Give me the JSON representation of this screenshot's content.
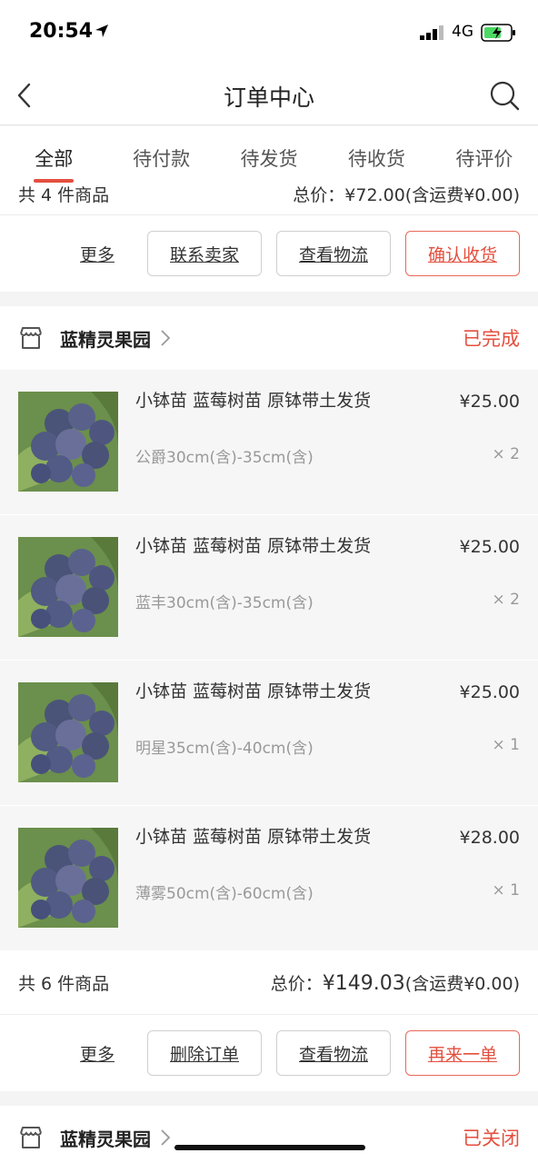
{
  "status_bar": {
    "time": "20:54",
    "network": "4G"
  },
  "nav": {
    "title": "订单中心"
  },
  "tabs": [
    {
      "label": "全部",
      "active": true
    },
    {
      "label": "待付款"
    },
    {
      "label": "待发货"
    },
    {
      "label": "待收货"
    },
    {
      "label": "待评价"
    }
  ],
  "prev_order": {
    "summary_count": "共 4 件商品",
    "summary_total": "总价：¥72.00(含运费¥0.00)",
    "actions": {
      "more": "更多",
      "contact": "联系卖家",
      "logistics": "查看物流",
      "confirm": "确认收货"
    }
  },
  "order": {
    "shop_name": "蓝精灵果园",
    "status": "已完成",
    "items": [
      {
        "title": "小钵苗 蓝莓树苗 原钵带土发货",
        "spec": "公爵30cm(含)-35cm(含)",
        "price": "¥25.00",
        "qty": "× 2"
      },
      {
        "title": "小钵苗 蓝莓树苗 原钵带土发货",
        "spec": "蓝丰30cm(含)-35cm(含)",
        "price": "¥25.00",
        "qty": "× 2"
      },
      {
        "title": "小钵苗 蓝莓树苗 原钵带土发货",
        "spec": "明星35cm(含)-40cm(含)",
        "price": "¥25.00",
        "qty": "× 1"
      },
      {
        "title": "小钵苗 蓝莓树苗 原钵带土发货",
        "spec": "薄雾50cm(含)-60cm(含)",
        "price": "¥28.00",
        "qty": "× 1"
      }
    ],
    "summary_count": "共 6 件商品",
    "summary_total_label": "总价：",
    "summary_total_value": "¥149.03",
    "summary_shipping": "(含运费¥0.00)",
    "actions": {
      "more": "更多",
      "delete": "删除订单",
      "logistics": "查看物流",
      "reorder": "再来一单"
    }
  },
  "next_order": {
    "shop_name": "蓝精灵果园",
    "status": "已关闭"
  },
  "colors": {
    "accent": "#e44f3e",
    "background": "#f4f4f4"
  }
}
